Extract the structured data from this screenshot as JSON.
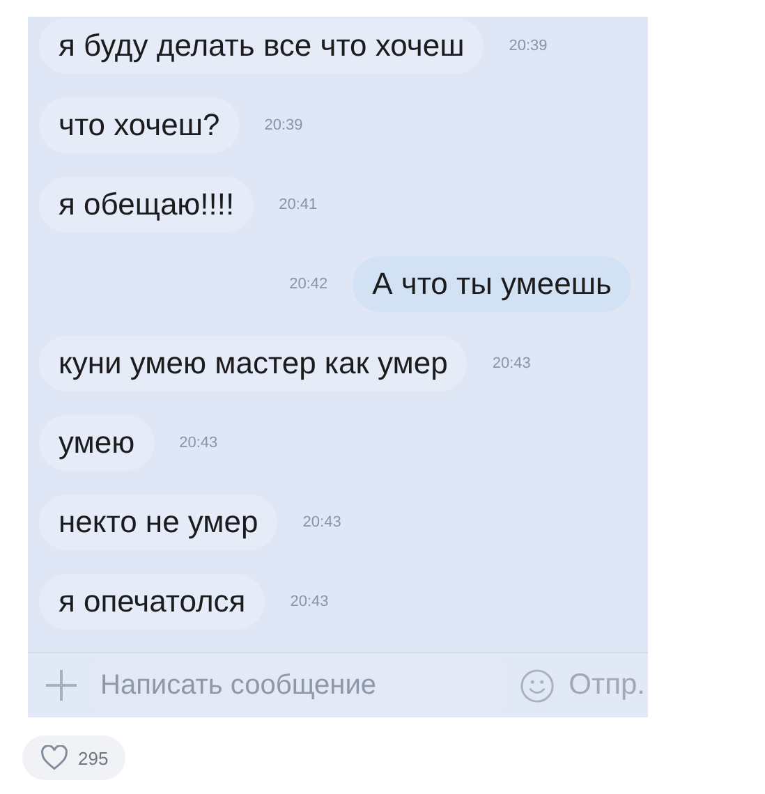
{
  "chat": {
    "messages": [
      {
        "kind": "incoming",
        "text": "я буду делать все что хочеш",
        "time": "20:39"
      },
      {
        "kind": "incoming",
        "text": "что хочеш?",
        "time": "20:39"
      },
      {
        "kind": "incoming",
        "text": "я обещаю!!!!",
        "time": "20:41"
      },
      {
        "kind": "outgoing",
        "text": "А что ты умеешь",
        "time": "20:42"
      },
      {
        "kind": "incoming",
        "text": "куни умею мастер как умер",
        "time": "20:43"
      },
      {
        "kind": "incoming",
        "text": "умею",
        "time": "20:43"
      },
      {
        "kind": "incoming",
        "text": "некто не умер",
        "time": "20:43"
      },
      {
        "kind": "incoming",
        "text": "я опечатолся",
        "time": "20:43"
      }
    ],
    "composer": {
      "placeholder": "Написать сообщение",
      "send": "Отпр."
    }
  },
  "likes": {
    "count": "295"
  }
}
